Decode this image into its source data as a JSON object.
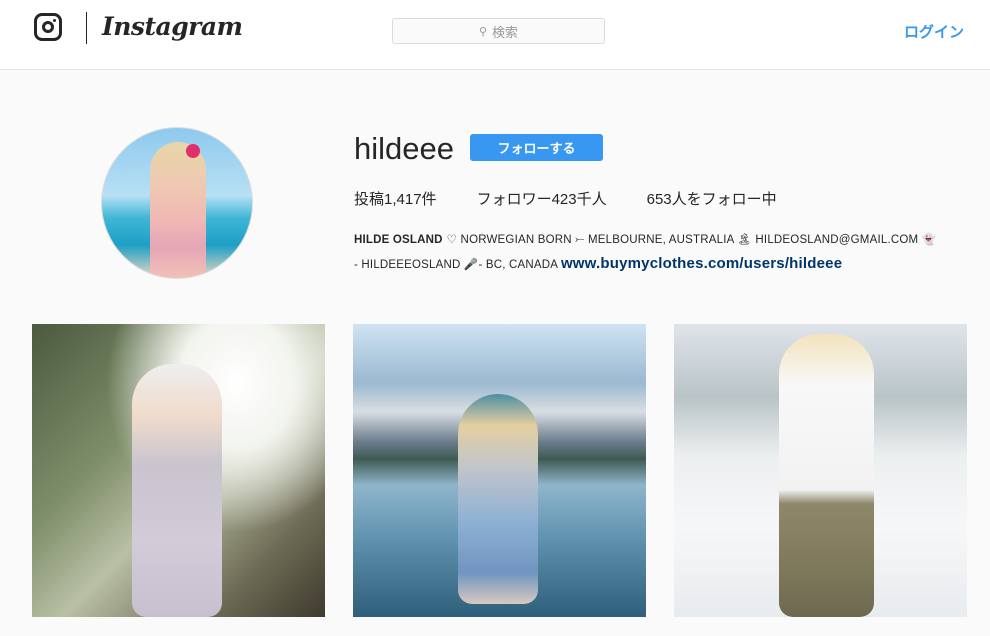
{
  "header": {
    "brand": "Instagram",
    "search": {
      "placeholder": "検索",
      "icon": "search-icon"
    },
    "login_label": "ログイン"
  },
  "profile": {
    "username": "hildeee",
    "follow_label": "フォローする",
    "stats": {
      "posts_label": "投稿",
      "posts_count": "1,417件",
      "followers_label": "フォロワー",
      "followers_count": "423千人",
      "following_text": "653人をフォロー中"
    },
    "bio": {
      "name": "HILDE OSLAND",
      "line1": "♡ NORWEGIAN BORN ⤚ MELBOURNE, AUSTRALIA 🏝 HILDEOSLAND@GMAIL.COM 👻",
      "line2": "- HILDEEEOSLAND 🎤- BC, CANADA",
      "link": "www.buymyclothes.com/users/hildeee"
    }
  },
  "colors": {
    "accent": "#3897f0",
    "link": "#003569",
    "background": "#fafafa"
  }
}
